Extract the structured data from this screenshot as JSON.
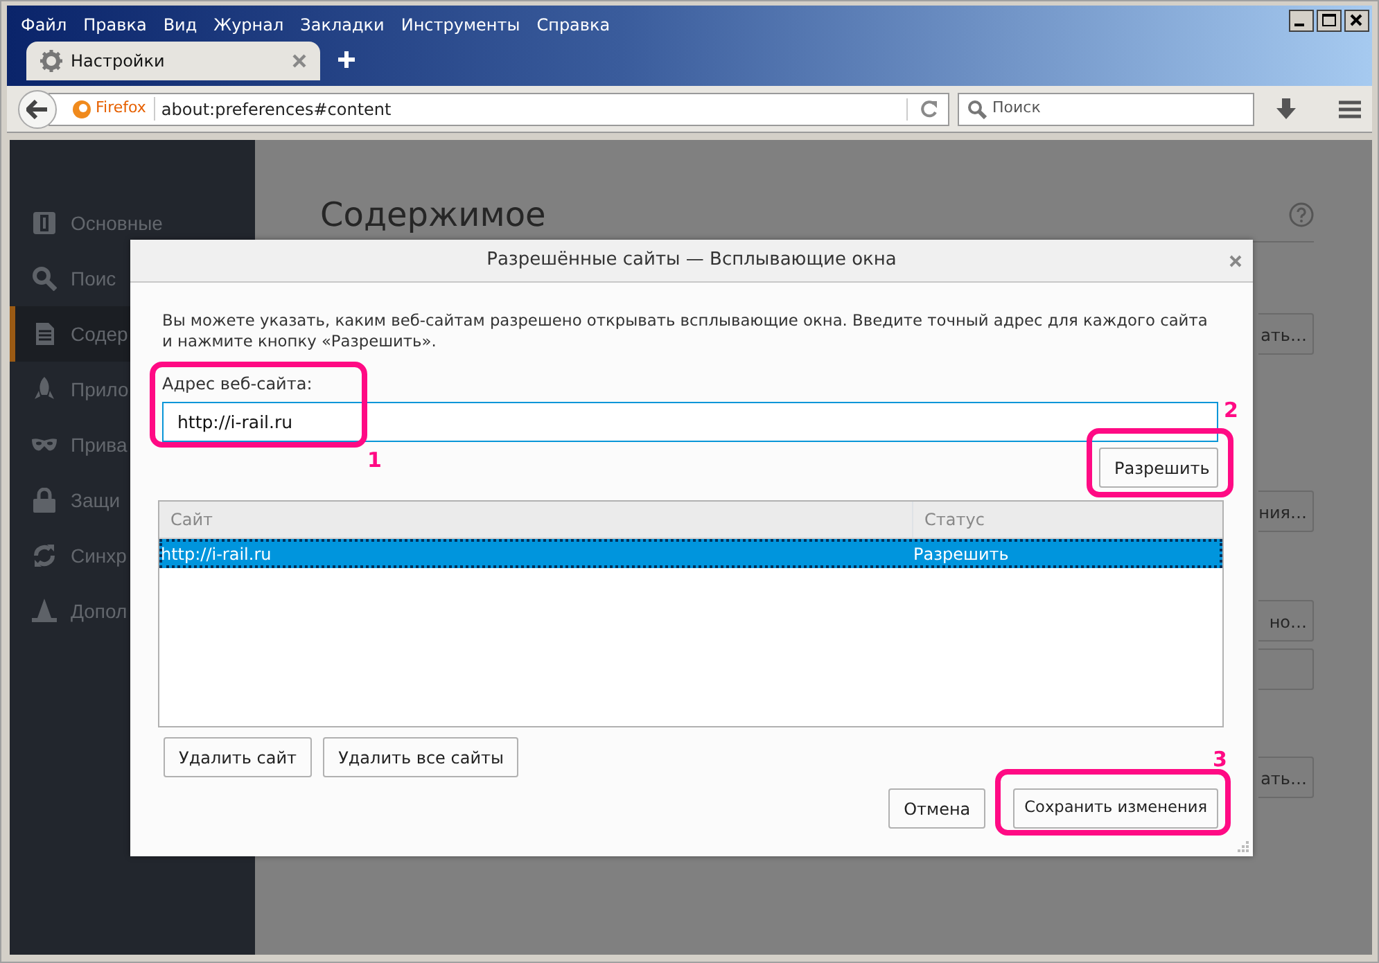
{
  "window": {
    "menu": [
      "Файл",
      "Правка",
      "Вид",
      "Журнал",
      "Закладки",
      "Инструменты",
      "Справка"
    ]
  },
  "tabs": [
    {
      "label": "Настройки",
      "selected": true
    }
  ],
  "toolbar": {
    "identity": "Firefox",
    "url": "about:preferences#content",
    "search": {
      "placeholder": "Поиск"
    }
  },
  "sidebar": {
    "items": [
      {
        "label": "Основные",
        "selected": false
      },
      {
        "label": "Поис",
        "selected": false
      },
      {
        "label": "Содер",
        "selected": true
      },
      {
        "label": "Прило",
        "selected": false
      },
      {
        "label": "Прива",
        "selected": false
      },
      {
        "label": "Защи",
        "selected": false
      },
      {
        "label": "Синхр",
        "selected": false
      },
      {
        "label": "Допол",
        "selected": false
      }
    ]
  },
  "page": {
    "heading": "Содержимое",
    "controls": [
      {
        "kind": "button",
        "label": "ать…"
      },
      {
        "kind": "button",
        "label": "ния…"
      },
      {
        "kind": "button",
        "label": "но…"
      },
      {
        "kind": "field"
      },
      {
        "kind": "button",
        "label": "ать…"
      }
    ]
  },
  "dialog": {
    "title": "Разрешённые сайты — Всплывающие окна",
    "description": "Вы можете указать, каким веб-сайтам разрешено открывать всплывающие окна. Введите точный адрес для каждого сайта и нажмите кнопку «Разрешить».",
    "address_label": "Адрес веб-сайта:",
    "address_value": "http://i-rail.ru",
    "allow_button": "Разрешить",
    "columns": [
      "Сайт",
      "Статус"
    ],
    "rows": [
      {
        "site": "http://i-rail.ru",
        "status": "Разрешить",
        "selected": true
      }
    ],
    "remove_buttons": [
      "Удалить сайт",
      "Удалить все сайты"
    ],
    "footer_buttons": [
      "Отмена",
      "Сохранить изменения"
    ]
  },
  "annotations": [
    {
      "label": "1"
    },
    {
      "label": "2"
    },
    {
      "label": "3"
    }
  ]
}
